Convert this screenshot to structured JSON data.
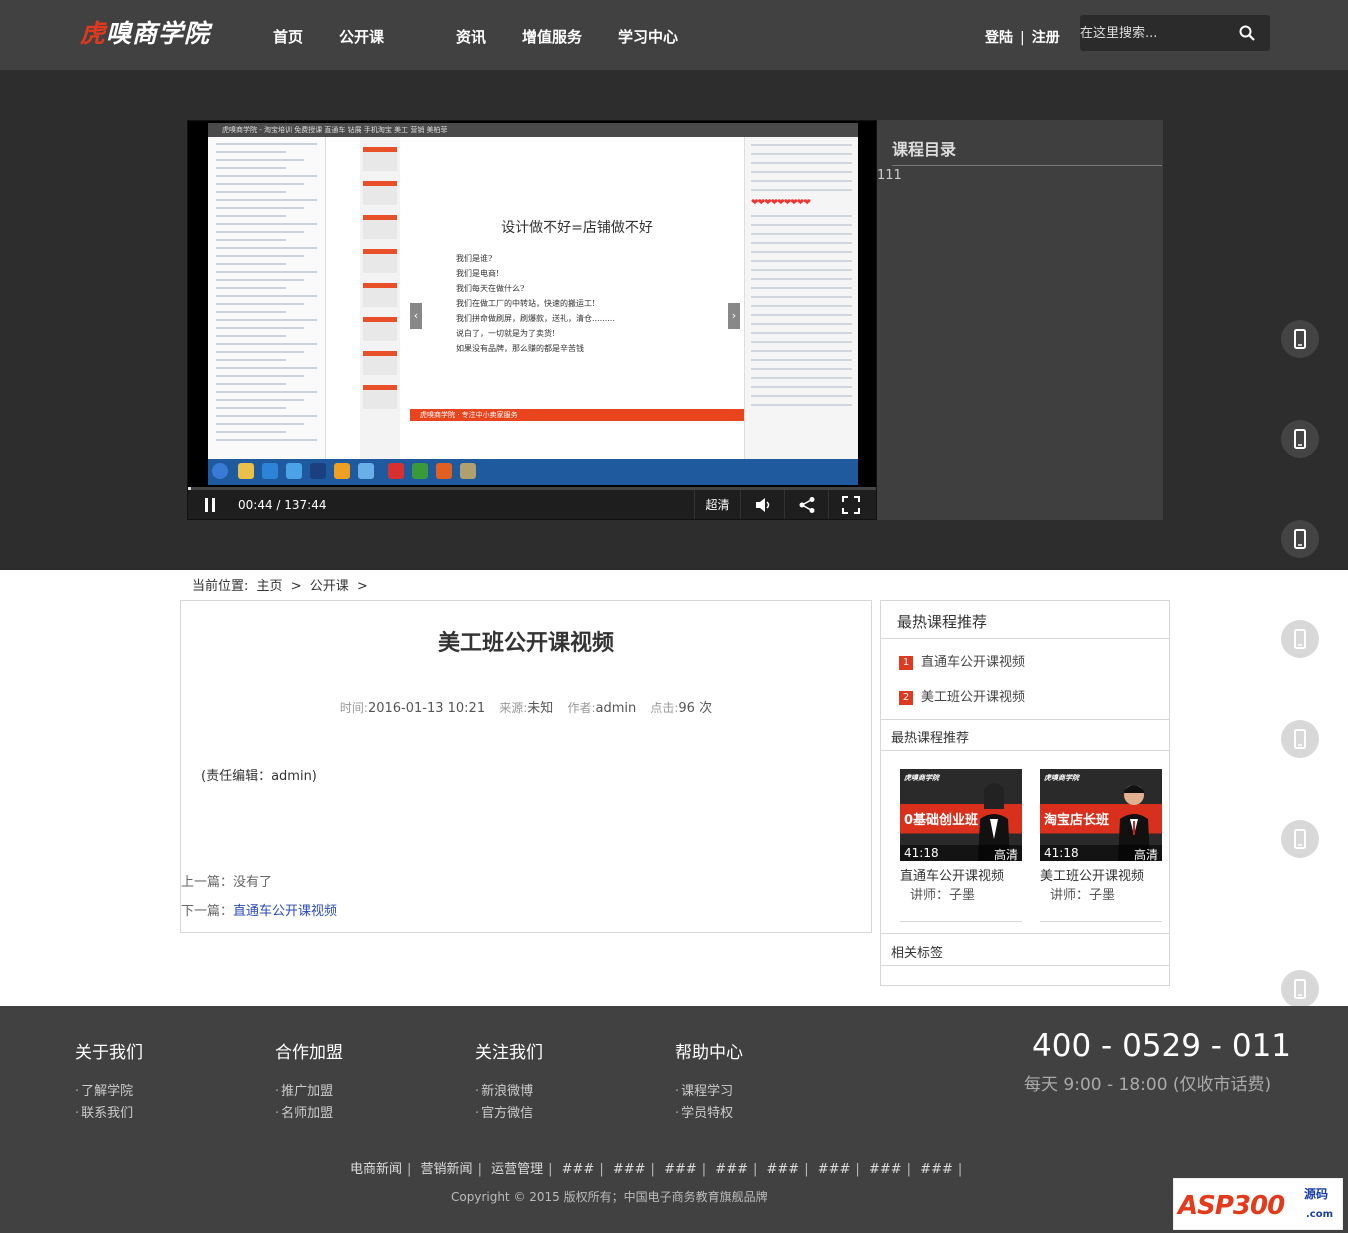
{
  "header": {
    "logo_prefix": "虎",
    "logo_rest": "嗅商学院",
    "nav": [
      "首页",
      "公开课",
      "资讯",
      "增值服务",
      "学习中心"
    ],
    "login": "登陆",
    "divider": "|",
    "register": "注册",
    "search_placeholder": "在这里搜索..."
  },
  "player": {
    "window_title": "虎嗅商学院 - 淘宝培训 免费授课 直通车 钻展 手机淘宝 美工 营销 美柏菲",
    "slide_title": "设计做不好=店铺做不好",
    "slide_lines": [
      "我们是谁?",
      "我们是电商!",
      "我们每天在做什么?",
      "我们在做工厂的中转站，快速的搬运工!",
      "我们拼命做刷屏，刷爆款，送礼，清仓.........",
      "说白了，一切就是为了卖货!",
      "如果没有品牌，那么赚的都是辛苦钱"
    ],
    "slide_bar_text": "虎嗅商学院 · 专注中小卖家服务",
    "hearts": "❤❤❤❤❤❤❤❤❤",
    "time": "00:44 / 137:44",
    "progress": 0.005,
    "quality": "超清",
    "catalog_title": "课程目录",
    "catalog_item": "111"
  },
  "breadcrumb": {
    "label": "当前位置:",
    "items": [
      "主页",
      ">",
      "公开课",
      ">"
    ]
  },
  "article": {
    "title": "美工班公开课视频",
    "meta": {
      "time_label": "时间:",
      "time": "2016-01-13 10:21",
      "source_label": "来源:",
      "source": "未知",
      "author_label": "作者:",
      "author": "admin",
      "views_label": "点击:",
      "views": "96 次"
    },
    "editor": "(责任编辑：admin)",
    "prev_label": "上一篇：",
    "prev": "没有了",
    "next_label": "下一篇：",
    "next": "直通车公开课视频"
  },
  "sidebar": {
    "hot_title": "最热课程推荐",
    "ranks": [
      {
        "num": "1",
        "title": "直通车公开课视频"
      },
      {
        "num": "2",
        "title": "美工班公开课视频"
      }
    ],
    "hot_title2": "最热课程推荐",
    "cards": [
      {
        "brand": "虎嗅商学院",
        "big": "0基础创业班",
        "duration": "41:18",
        "hd": "高清",
        "name": "直通车公开课视频",
        "teacher": "讲师：子墨"
      },
      {
        "brand": "虎嗅商学院",
        "big": "淘宝店长班",
        "duration": "41:18",
        "hd": "高清",
        "name": "美工班公开课视频",
        "teacher": "讲师：子墨"
      }
    ],
    "tags_title": "相关标签"
  },
  "footer": {
    "cols": [
      {
        "title": "关于我们",
        "items": [
          "了解学院",
          "联系我们"
        ]
      },
      {
        "title": "合作加盟",
        "items": [
          "推广加盟",
          "名师加盟"
        ]
      },
      {
        "title": "关注我们",
        "items": [
          "新浪微博",
          "官方微信"
        ]
      },
      {
        "title": "帮助中心",
        "items": [
          "课程学习",
          "学员特权"
        ]
      }
    ],
    "phone": "400 - 0529 - 011",
    "hours": "每天 9:00 - 18:00 (仅收市话费)",
    "links": [
      "电商新闻",
      "营销新闻",
      "运营管理",
      "###",
      "###",
      "###",
      "###",
      "###",
      "###",
      "###",
      "###"
    ],
    "copyright": "Copyright © 2015 版权所有；中国电子商务教育旗舰品牌"
  },
  "watermark": {
    "text": "ASP300",
    "sub": "源码",
    "com": ".com"
  },
  "colors": {
    "header_bg": "#414141",
    "accent": "#e03a1e",
    "link": "#2a4bb8"
  }
}
